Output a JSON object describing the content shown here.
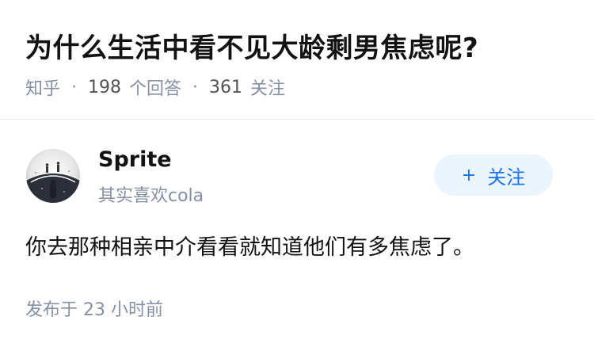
{
  "question": {
    "title": "为什么生活中看不见大龄剩男焦虑呢?",
    "source": "知乎",
    "answer_count": "198",
    "answer_label": "个回答",
    "follower_count": "361",
    "follower_label": "关注",
    "separator": "·"
  },
  "answer": {
    "author_name": "Sprite",
    "author_headline": "其实喜欢cola",
    "follow_plus": "+",
    "follow_label": "关注",
    "content": "你去那种相亲中介看看就知道他们有多焦虑了。",
    "publish_time": "发布于 23 小时前"
  },
  "colors": {
    "accent": "#1772f6",
    "follow_bg": "#ebf5fd",
    "meta_text": "#8590a6",
    "title_text": "#121212"
  },
  "icons": {
    "avatar": "avatar-image"
  }
}
